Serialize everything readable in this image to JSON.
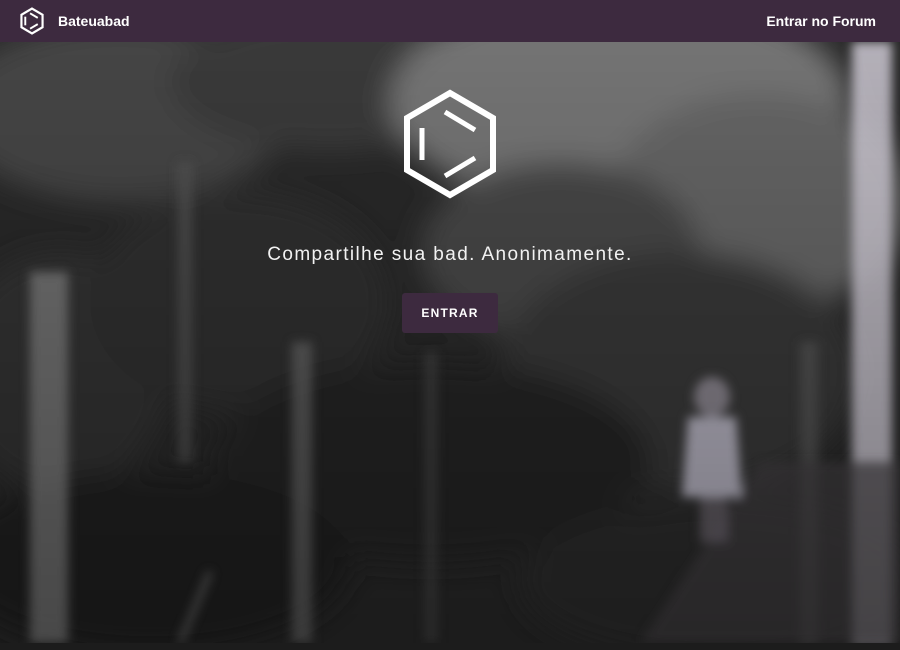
{
  "navbar": {
    "brand_name": "Bateuabad",
    "forum_link": "Entrar no Forum",
    "brand_icon": "hexagon-logo-icon"
  },
  "hero": {
    "logo_icon": "hexagon-logo-icon",
    "tagline": "Compartilhe sua bad. Anonimamente.",
    "cta_label": "ENTRAR",
    "background": "blurred-forest-stairs-photo"
  },
  "colors": {
    "navbar_bg": "#3d2a3f",
    "button_bg": "#3d2a3f",
    "text": "#ffffff"
  }
}
